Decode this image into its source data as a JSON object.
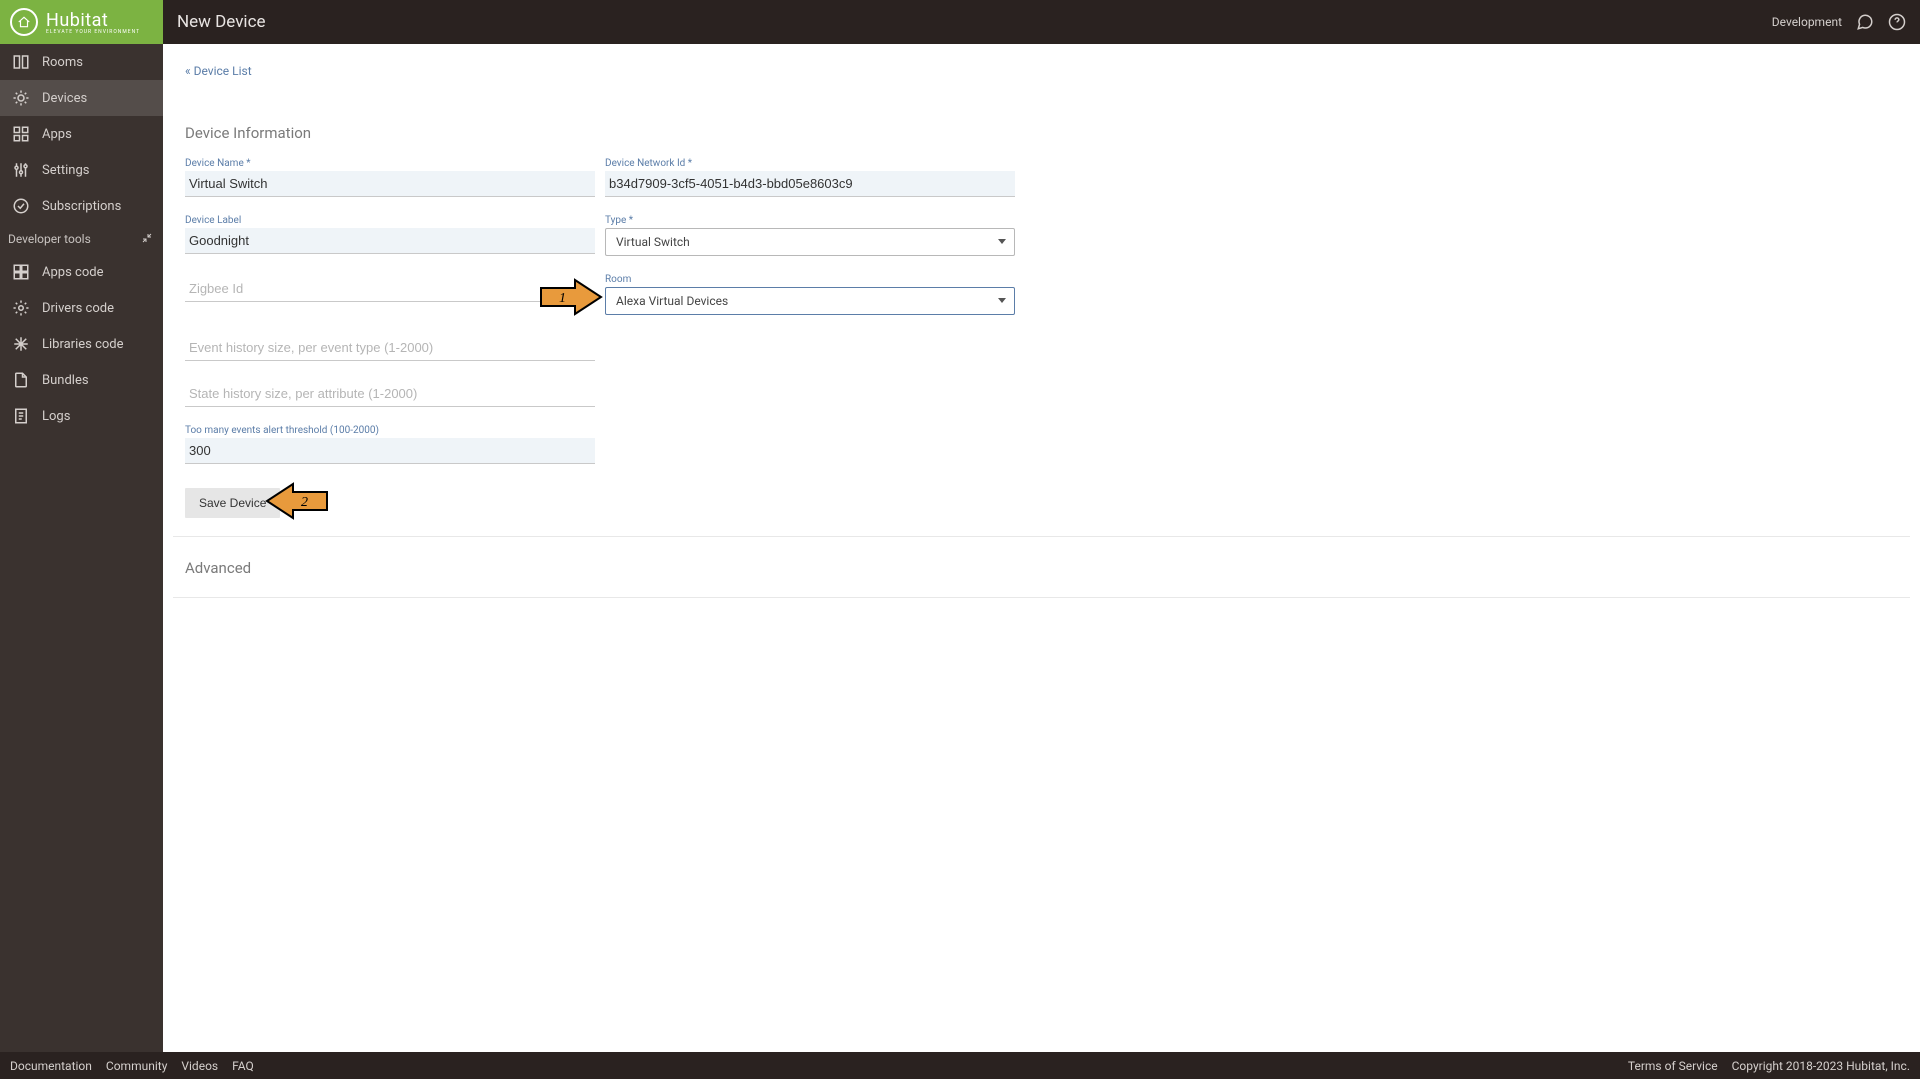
{
  "header": {
    "page_title": "New Device",
    "environment": "Development",
    "logo_main": "Hubitat",
    "logo_sub": "ELEVATE YOUR ENVIRONMENT"
  },
  "sidebar": {
    "items": [
      {
        "label": "Rooms",
        "icon": "rooms-icon"
      },
      {
        "label": "Devices",
        "icon": "devices-icon"
      },
      {
        "label": "Apps",
        "icon": "apps-icon"
      },
      {
        "label": "Settings",
        "icon": "settings-icon"
      },
      {
        "label": "Subscriptions",
        "icon": "subscriptions-icon"
      }
    ],
    "dev_header": "Developer tools",
    "dev_items": [
      {
        "label": "Apps code",
        "icon": "apps-code-icon"
      },
      {
        "label": "Drivers code",
        "icon": "drivers-code-icon"
      },
      {
        "label": "Libraries code",
        "icon": "libraries-code-icon"
      },
      {
        "label": "Bundles",
        "icon": "bundles-icon"
      },
      {
        "label": "Logs",
        "icon": "logs-icon"
      }
    ]
  },
  "breadcrumb": "« Device List",
  "section_title": "Device Information",
  "form": {
    "device_name": {
      "label": "Device Name *",
      "value": "Virtual Switch"
    },
    "device_network_id": {
      "label": "Device Network Id *",
      "value": "b34d7909-3cf5-4051-b4d3-bbd05e8603c9"
    },
    "device_label": {
      "label": "Device Label",
      "value": "Goodnight"
    },
    "type": {
      "label": "Type *",
      "value": "Virtual Switch"
    },
    "zigbee_id": {
      "label": "",
      "placeholder": "Zigbee Id",
      "value": ""
    },
    "room": {
      "label": "Room",
      "value": "Alexa Virtual Devices"
    },
    "event_history": {
      "label": "",
      "placeholder": "Event history size, per event type (1-2000)",
      "value": ""
    },
    "state_history": {
      "label": "",
      "placeholder": "State history size, per attribute (1-2000)",
      "value": ""
    },
    "alert_threshold": {
      "label": "Too many events alert threshold (100-2000)",
      "value": "300"
    }
  },
  "save_button": "Save Device",
  "advanced_title": "Advanced",
  "annotations": {
    "arrow1": "1",
    "arrow2": "2"
  },
  "footer": {
    "left": [
      "Documentation",
      "Community",
      "Videos",
      "FAQ"
    ],
    "right": [
      "Terms of Service",
      "Copyright 2018-2023 Hubitat, Inc."
    ]
  }
}
